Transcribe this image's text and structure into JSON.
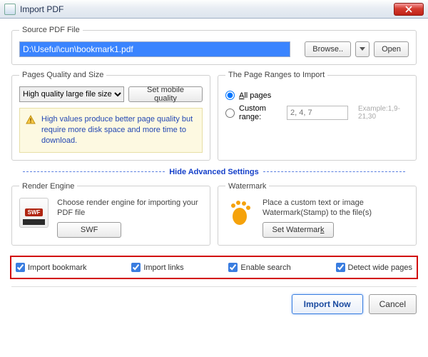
{
  "window": {
    "title": "Import PDF"
  },
  "source": {
    "legend": "Source PDF File",
    "path": "D:\\Useful\\cun\\bookmark1.pdf",
    "browse": "Browse..",
    "open": "Open"
  },
  "quality": {
    "legend": "Pages Quality and Size",
    "selected": "High quality large file size",
    "mobile_btn": "Set mobile quality",
    "info": "High values produce better page quality but require more disk space and more time to download."
  },
  "ranges": {
    "legend": "The Page Ranges to Import",
    "all": "All pages",
    "custom": "Custom range:",
    "placeholder": "2, 4, 7",
    "example": "Example:1,9-21,30"
  },
  "divider": "Hide Advanced Settings",
  "render": {
    "legend": "Render Engine",
    "desc": "Choose render engine for importing your PDF file",
    "swf_btn": "SWF",
    "swf_tag": "SWF"
  },
  "watermark": {
    "legend": "Watermark",
    "desc": "Place a custom text or image Watermark(Stamp) to the file(s)",
    "btn": "Set Watermark"
  },
  "checks": {
    "bookmark": "Import bookmark",
    "links": "Import links",
    "search": "Enable search",
    "wide": "Detect wide pages"
  },
  "footer": {
    "import": "Import Now",
    "cancel": "Cancel"
  }
}
